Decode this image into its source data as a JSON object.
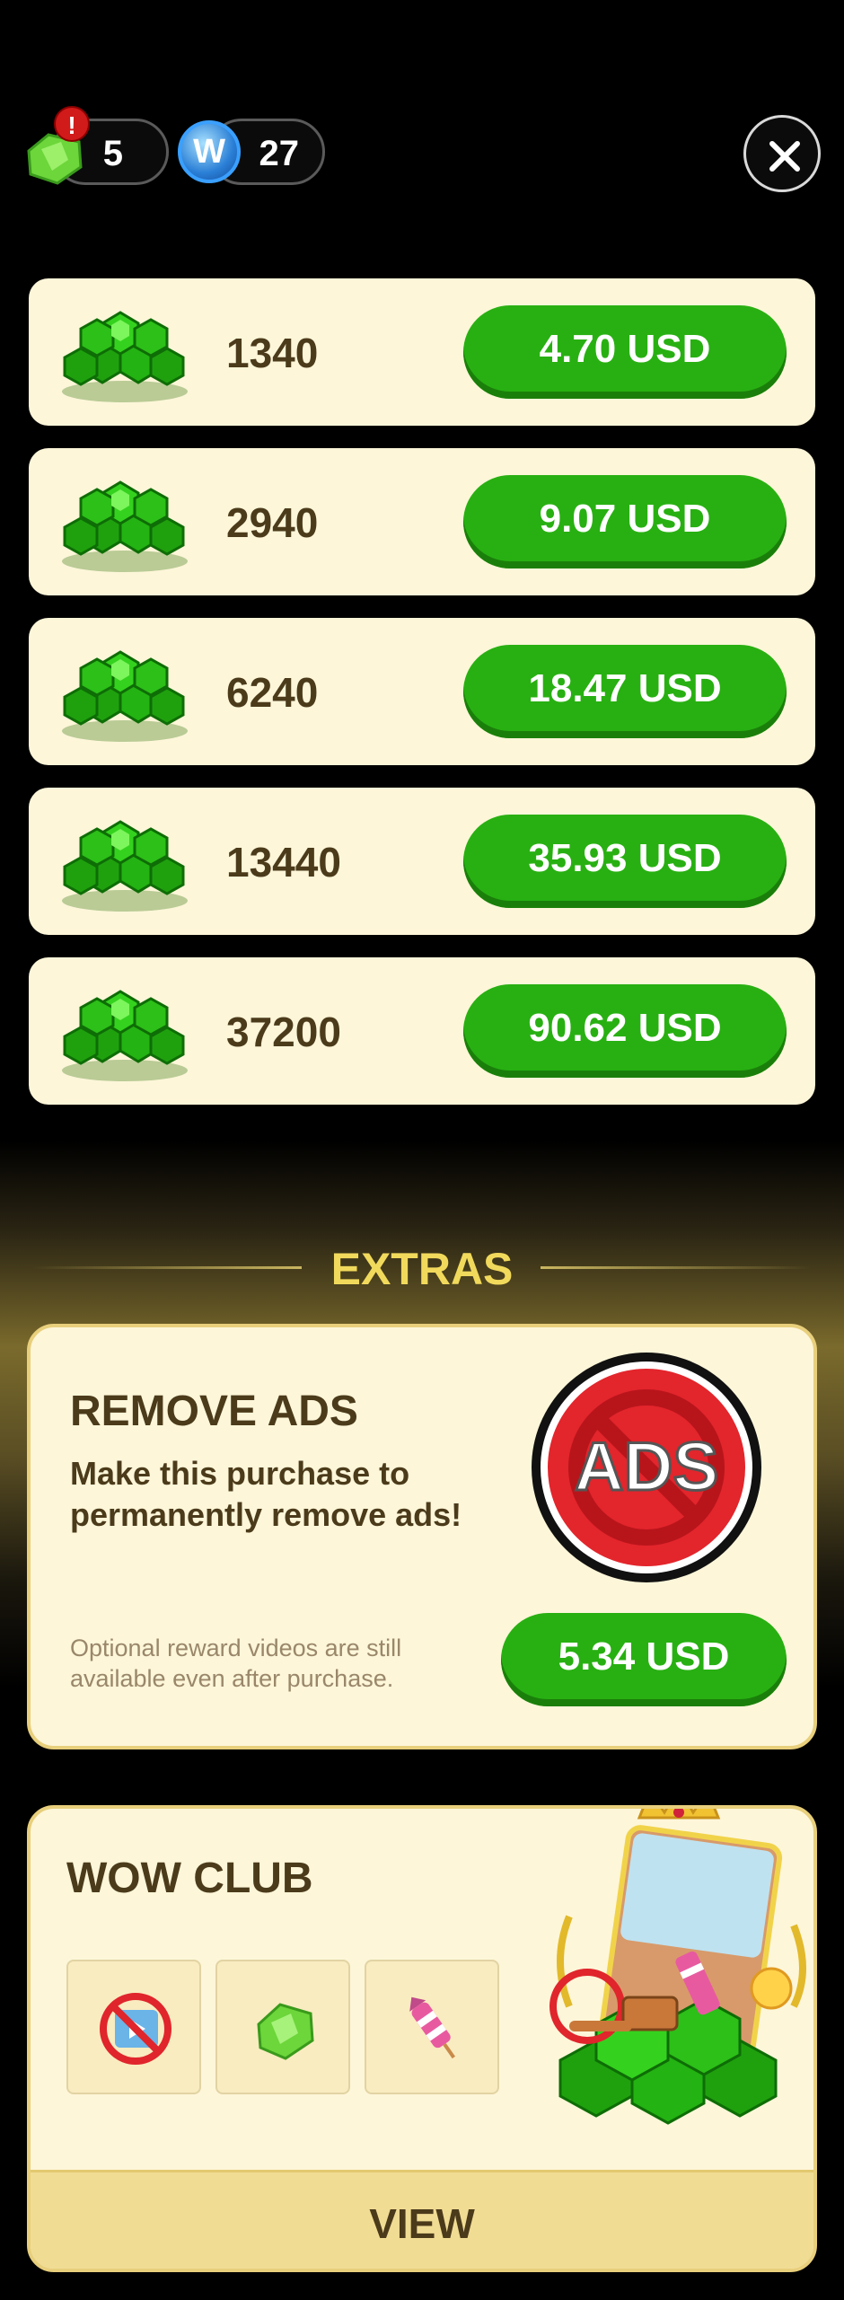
{
  "header": {
    "gems_count": "5",
    "alert_badge": "!",
    "coin_letter": "W",
    "coins_count": "27"
  },
  "packs": [
    {
      "amount": "1340",
      "price": "4.70 USD"
    },
    {
      "amount": "2940",
      "price": "9.07 USD"
    },
    {
      "amount": "6240",
      "price": "18.47 USD"
    },
    {
      "amount": "13440",
      "price": "35.93 USD"
    },
    {
      "amount": "37200",
      "price": "90.62 USD"
    }
  ],
  "extras": {
    "title": "EXTRAS",
    "remove_ads": {
      "title": "REMOVE ADS",
      "description": "Make this purchase to permanently remove ads!",
      "note": "Optional reward videos are still available even after purchase.",
      "icon_text": "ADS",
      "price": "5.34 USD"
    },
    "wow_club": {
      "title": "WOW CLUB",
      "perks": [
        "no-ads-video-icon",
        "gem-icon",
        "firework-rocket-icon"
      ],
      "view_label": "VIEW"
    }
  },
  "colors": {
    "background": "#000000",
    "card": "#fdf6d9",
    "price_button": "#28b012",
    "text_dark": "#4b3b1b",
    "extras_title": "#f1d95c"
  }
}
